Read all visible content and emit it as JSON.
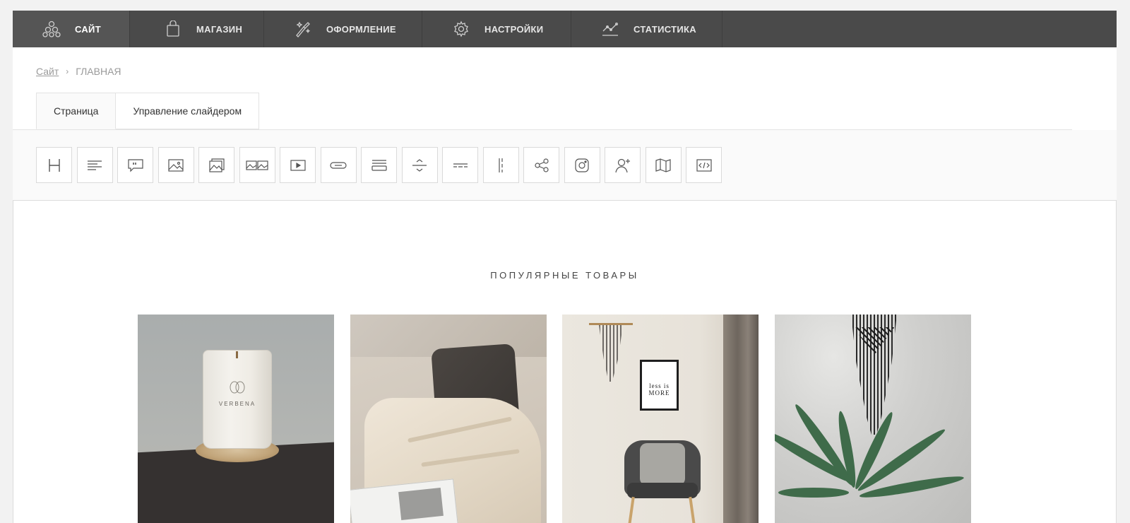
{
  "nav": {
    "items": [
      {
        "label": "САЙТ",
        "icon": "site-circles-icon",
        "active": true
      },
      {
        "label": "МАГАЗИН",
        "icon": "shopping-bag-icon",
        "active": false
      },
      {
        "label": "ОФОРМЛЕНИЕ",
        "icon": "magic-brush-icon",
        "active": false
      },
      {
        "label": "НАСТРОЙКИ",
        "icon": "gear-icon",
        "active": false
      },
      {
        "label": "СТАТИСТИКА",
        "icon": "line-chart-icon",
        "active": false
      }
    ]
  },
  "breadcrumb": {
    "root": "Сайт",
    "separator": "›",
    "current": "ГЛАВНАЯ"
  },
  "tabs": [
    {
      "label": "Страница",
      "active": true
    },
    {
      "label": "Управление слайдером",
      "active": false
    }
  ],
  "toolbar": {
    "tools": [
      "heading-icon",
      "text-icon",
      "quote-icon",
      "image-icon",
      "gallery-icon",
      "double-image-icon",
      "video-icon",
      "button-icon",
      "columns-icon",
      "spacer-icon",
      "divider-icon",
      "vertical-divider-icon",
      "share-icon",
      "instagram-icon",
      "subscribe-user-icon",
      "map-icon",
      "code-icon"
    ]
  },
  "content": {
    "section_title": "ПОПУЛЯРНЫЕ ТОВАРЫ",
    "products": [
      {
        "name": "candle",
        "brand": "VERBENA"
      },
      {
        "name": "pillow"
      },
      {
        "name": "chair",
        "frame_text": "less is MORE"
      },
      {
        "name": "palm-wall-hanging"
      }
    ]
  },
  "colors": {
    "topnav": "#4a4a4a",
    "active_nav": "#555555",
    "page_bg": "#f2f2f2"
  }
}
